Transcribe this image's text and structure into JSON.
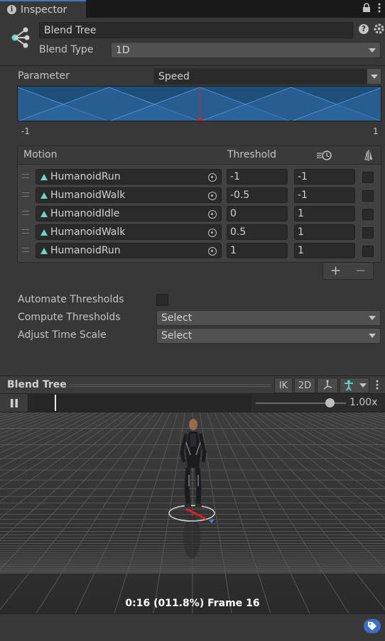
{
  "tab": {
    "title": "Inspector"
  },
  "header": {
    "name_value": "Blend Tree",
    "blend_type_label": "Blend Type",
    "blend_type_value": "1D"
  },
  "parameter": {
    "label": "Parameter",
    "value": "Speed"
  },
  "graph": {
    "min_label": "-1",
    "max_label": "1",
    "marker_value": 0
  },
  "motion_list": {
    "col_motion": "Motion",
    "col_threshold": "Threshold",
    "rows": [
      {
        "clip": "HumanoidRun",
        "threshold": "-1",
        "speed": "-1"
      },
      {
        "clip": "HumanoidWalk",
        "threshold": "-0.5",
        "speed": "-1"
      },
      {
        "clip": "HumanoidIdle",
        "threshold": "0",
        "speed": "1"
      },
      {
        "clip": "HumanoidWalk",
        "threshold": "0.5",
        "speed": "1"
      },
      {
        "clip": "HumanoidRun",
        "threshold": "1",
        "speed": "1"
      }
    ],
    "add_label": "+",
    "remove_label": "−"
  },
  "options": {
    "automate_label": "Automate Thresholds",
    "compute_label": "Compute Thresholds",
    "compute_value": "Select",
    "adjust_label": "Adjust Time Scale",
    "adjust_value": "Select"
  },
  "preview": {
    "title": "Blend Tree",
    "ik_label": "IK",
    "twod_label": "2D",
    "speed_readout": "1.00x",
    "speed_fraction": 0.82,
    "status": "0:16 (011.8%) Frame 16"
  },
  "colors": {
    "accent": "#3a79bb",
    "graph_fill": "#1e4e7a",
    "marker": "#e02020",
    "clip_icon": "#6fd4c8"
  }
}
